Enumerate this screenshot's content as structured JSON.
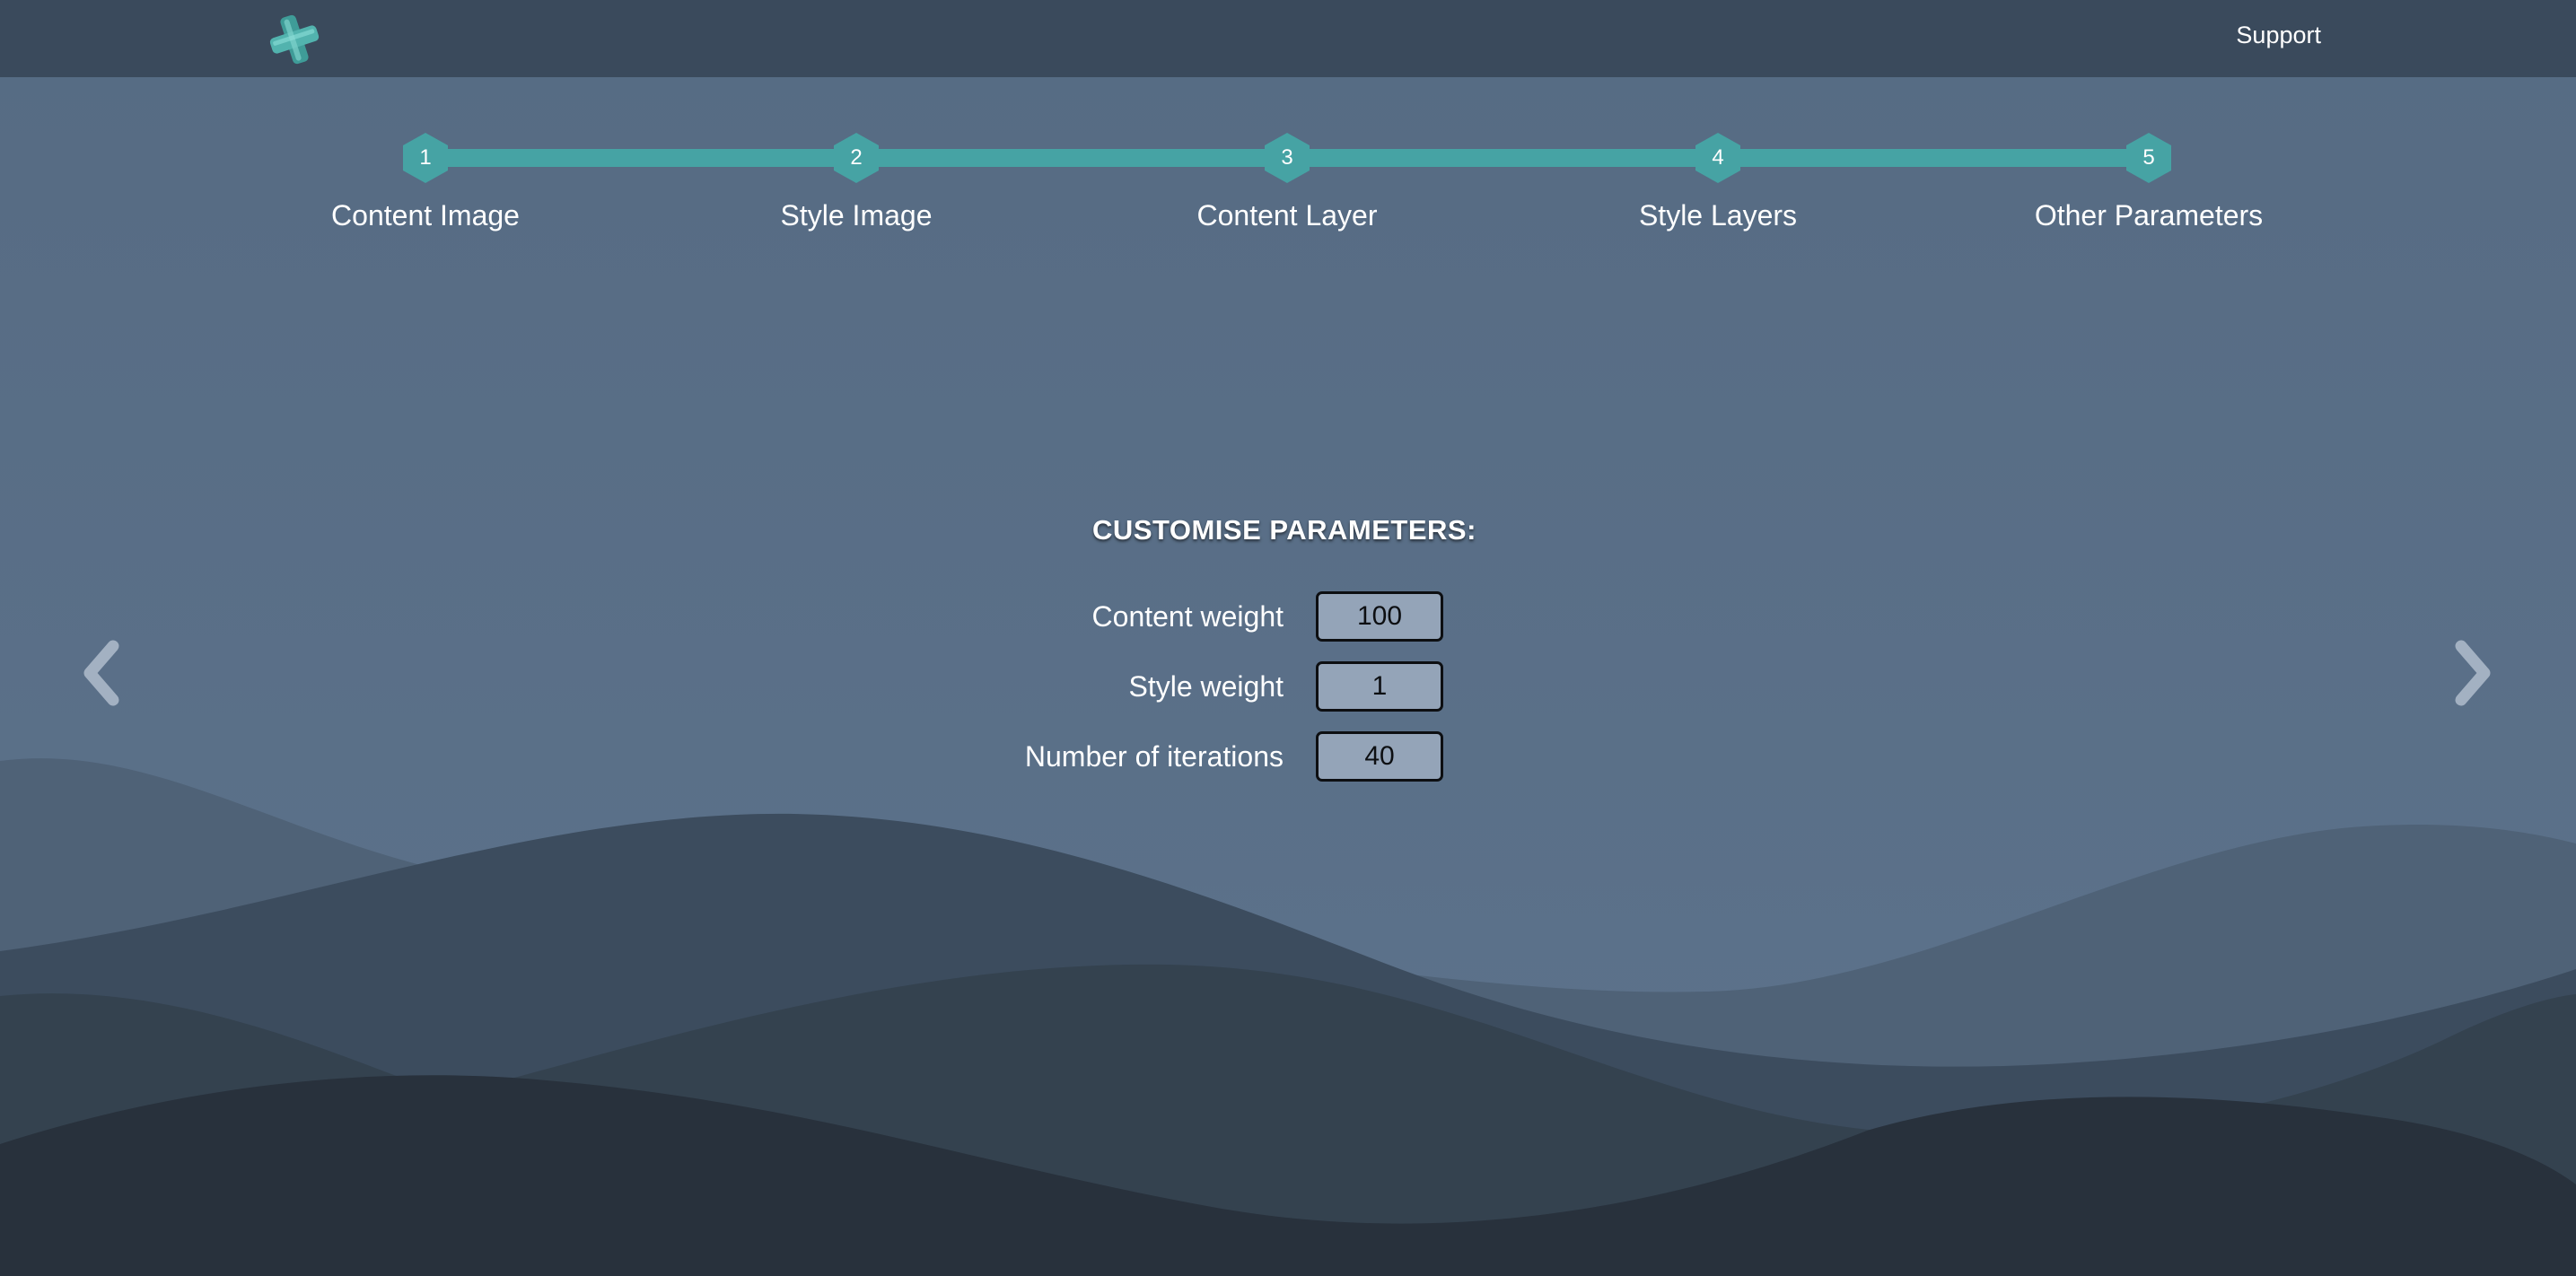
{
  "header": {
    "logo_icon": "teal-cross-logo",
    "support_label": "Support"
  },
  "stepper": {
    "steps": [
      {
        "number": "1",
        "label": "Content Image"
      },
      {
        "number": "2",
        "label": "Style Image"
      },
      {
        "number": "3",
        "label": "Content Layer"
      },
      {
        "number": "4",
        "label": "Style Layers"
      },
      {
        "number": "5",
        "label": "Other Parameters"
      }
    ],
    "accent_color": "#46a3a4"
  },
  "panel": {
    "title": "CUSTOMISE PARAMETERS:",
    "params": [
      {
        "label": "Content weight",
        "value": "100"
      },
      {
        "label": "Style weight",
        "value": "1"
      },
      {
        "label": "Number of iterations",
        "value": "40"
      }
    ]
  },
  "navigation": {
    "prev_icon": "chevron-left-icon",
    "next_icon": "chevron-right-icon"
  },
  "colors": {
    "header_bg": "#3a4a5c",
    "page_bg": "#5b7089",
    "input_bg": "#94a4b8"
  }
}
